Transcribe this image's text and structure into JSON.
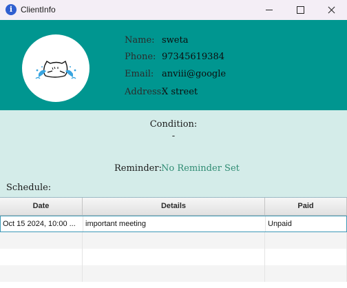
{
  "window": {
    "title": "ClientInfo",
    "icon": "info-icon",
    "buttons": [
      "minimize-icon",
      "maximize-icon",
      "close-icon"
    ]
  },
  "header": {
    "background": "#009690",
    "name_label": "Name:",
    "name_value": "sweta",
    "phone_label": "Phone:",
    "phone_value": "97345619384",
    "email_label": "Email:",
    "email_value": "anviii@google",
    "address_label": "Address:",
    "address_value": "X street"
  },
  "details": {
    "background": "#d4ece9",
    "condition_label": "Condition:",
    "condition_value": "-",
    "reminder_label": "Reminder:",
    "reminder_value": "No Reminder Set",
    "reminder_color": "#2e8b72",
    "schedule_label": "Schedule:"
  },
  "schedule_table": {
    "columns": [
      "Date",
      "Details",
      "Paid"
    ],
    "rows": [
      {
        "date": "Oct 15 2024, 10:00 ...",
        "details": "important meeting",
        "paid": "Unpaid"
      }
    ]
  }
}
